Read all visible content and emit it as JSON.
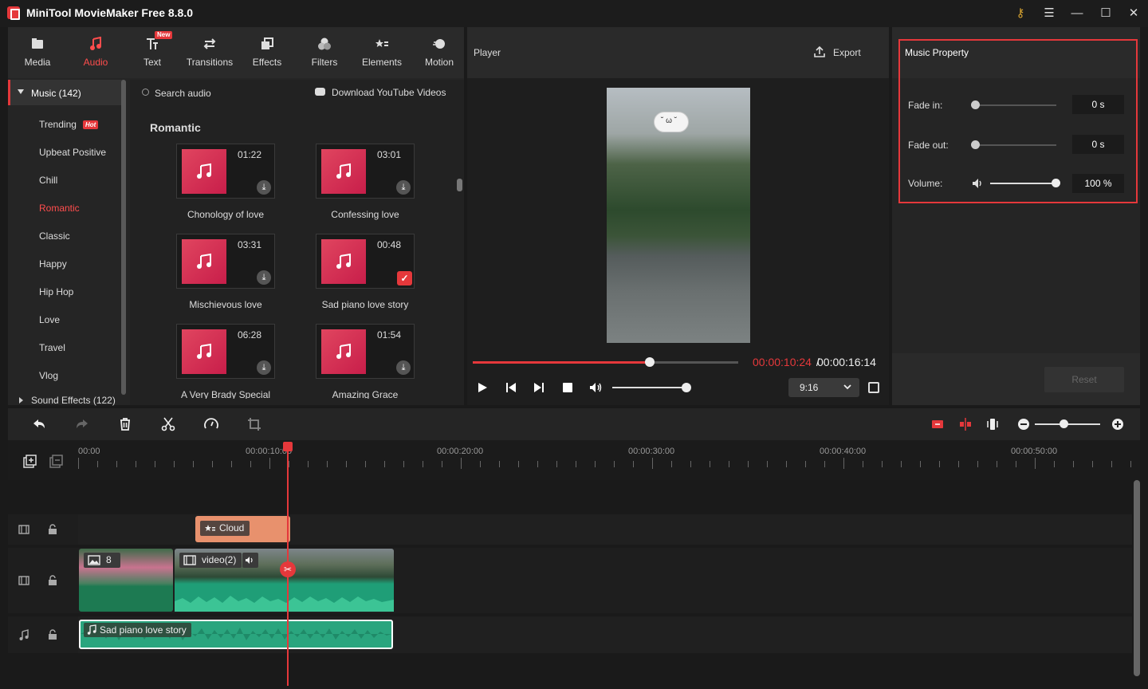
{
  "app": {
    "title": "MiniTool MovieMaker Free 8.8.0"
  },
  "toolbar": {
    "items": [
      {
        "label": "Media",
        "icon": "media-icon"
      },
      {
        "label": "Audio",
        "icon": "audio-icon",
        "active": true
      },
      {
        "label": "Text",
        "icon": "text-icon",
        "badge": "New"
      },
      {
        "label": "Transitions",
        "icon": "transitions-icon"
      },
      {
        "label": "Effects",
        "icon": "effects-icon"
      },
      {
        "label": "Filters",
        "icon": "filters-icon"
      },
      {
        "label": "Elements",
        "icon": "elements-icon"
      },
      {
        "label": "Motion",
        "icon": "motion-icon"
      }
    ]
  },
  "categories": {
    "music": "Music (142)",
    "items": [
      "Trending",
      "Upbeat Positive",
      "Chill",
      "Romantic",
      "Classic",
      "Happy",
      "Hip Hop",
      "Love",
      "Travel",
      "Vlog"
    ],
    "hot_badge": "Hot",
    "sound_effects": "Sound Effects (122)"
  },
  "audio": {
    "search_placeholder": "Search audio",
    "download_youtube": "Download YouTube Videos",
    "section": "Romantic",
    "tracks": [
      {
        "title": "Chonology of love",
        "duration": "01:22"
      },
      {
        "title": "Confessing love",
        "duration": "03:01"
      },
      {
        "title": "Mischievous love",
        "duration": "03:31"
      },
      {
        "title": "Sad piano love story",
        "duration": "00:48",
        "added": true
      },
      {
        "title": "A Very Brady Special",
        "duration": "06:28"
      },
      {
        "title": "Amazing Grace",
        "duration": "01:54"
      }
    ]
  },
  "player": {
    "label": "Player",
    "export": "Export",
    "current_time": "00:00:10:24",
    "separator": " / ",
    "total_time": "00:00:16:14",
    "progress": 0.667,
    "volume": 1.0,
    "aspect_ratio": "9:16"
  },
  "music_property": {
    "title": "Music Property",
    "fade_in_label": "Fade in:",
    "fade_in_value": "0 s",
    "fade_out_label": "Fade out:",
    "fade_out_value": "0 s",
    "volume_label": "Volume:",
    "volume_value": "100 %",
    "reset": "Reset"
  },
  "timeline": {
    "ruler": [
      "00:00",
      "00:00:10:00",
      "00:00:20:00",
      "00:00:30:00",
      "00:00:40:00",
      "00:00:50:00"
    ],
    "clips": {
      "element": "Cloud",
      "image_count": "8",
      "video": "video(2)",
      "audio": "Sad piano love story"
    }
  },
  "colors": {
    "accent": "#e5383b",
    "audio_clip": "#2aa57e",
    "element_clip": "#e8916d"
  }
}
